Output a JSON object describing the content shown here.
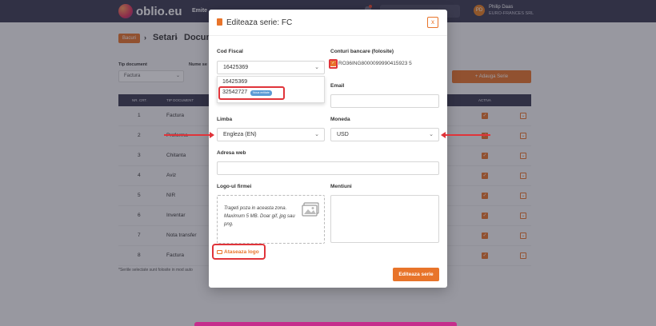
{
  "nav": {
    "brand": "oblio.eu",
    "menu_item": "Emite",
    "user_name": "Philip Daas",
    "user_company": "EURO-FRANCES SRL",
    "avatar_initials": "PD"
  },
  "breadcrumb": {
    "home": "Bacuri",
    "sep": "›",
    "settings": "Setari",
    "documents": "Docum"
  },
  "filters": {
    "doc_type_label": "Tip document",
    "name_label": "Nume se",
    "doc_type_value": "Factura",
    "add_series": "+ Adauga Serie"
  },
  "table": {
    "headers": [
      "NR. CRT.",
      "TIP DOCUMENT",
      "ACTIVA"
    ],
    "rows": [
      {
        "num": "1",
        "type": "Factura"
      },
      {
        "num": "2",
        "type": "Proforma"
      },
      {
        "num": "3",
        "type": "Chitanta"
      },
      {
        "num": "4",
        "type": "Aviz"
      },
      {
        "num": "5",
        "type": "NIR"
      },
      {
        "num": "6",
        "type": "Inventar"
      },
      {
        "num": "7",
        "type": "Nota transfer"
      },
      {
        "num": "8",
        "type": "Factura"
      }
    ],
    "footnote": "*Seriile selectate sunt folosite in mod auto"
  },
  "modal": {
    "title": "Editeaza serie: FC",
    "close": "x",
    "cod_fiscal_label": "Cod Fiscal",
    "cod_fiscal_value": "16425369",
    "cod_fiscal_options": [
      "16425369",
      "32542727"
    ],
    "option_badge": "Noua entitate",
    "conturi_label": "Conturi bancare (folosite)",
    "iban": "RO36ING8000099990415923 5",
    "email_label": "Email",
    "limba_label": "Limba",
    "limba_value": "Engleza (EN)",
    "moneda_label": "Moneda",
    "moneda_value": "USD",
    "web_label": "Adresa web",
    "logo_label": "Logo-ul firmei",
    "mentiuni_label": "Mentiuni",
    "logo_hint": "Trageti poza in aceasta zona. Maximum 5 MB. Doar gif, jpg sau png.",
    "attach_logo": "Ataseaza logo",
    "submit": "Editeaza serie"
  },
  "colors": {
    "accent": "#e8742a",
    "nav_bg": "#3a3950",
    "highlight": "#e0343a"
  }
}
